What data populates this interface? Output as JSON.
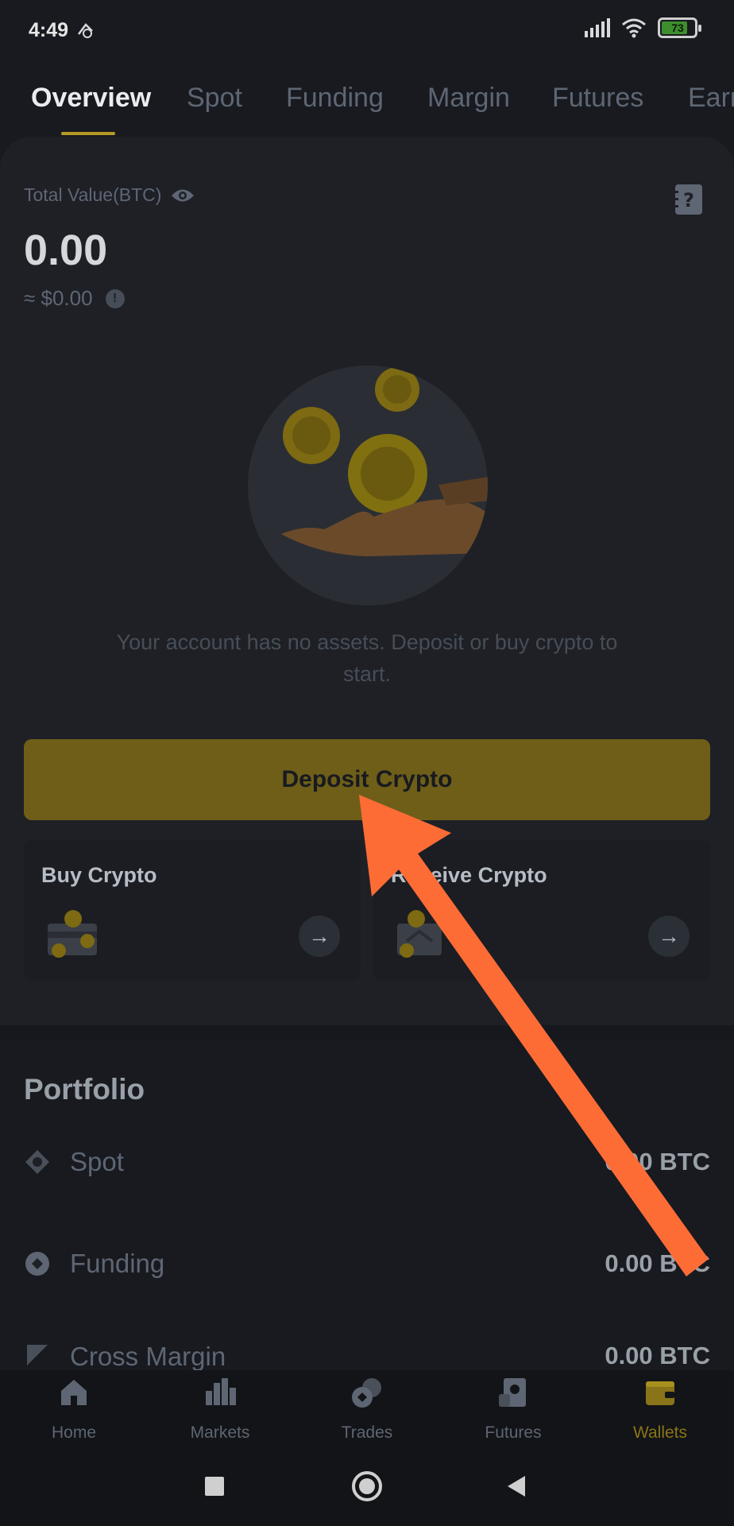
{
  "status_bar": {
    "time": "4:49",
    "battery_level": "73",
    "battery_fraction": 0.73
  },
  "tabs": [
    "Overview",
    "Spot",
    "Funding",
    "Margin",
    "Futures",
    "Earn"
  ],
  "overview": {
    "total_label": "Total Value(BTC)",
    "total_value": "0.00",
    "total_fiat": "≈ $0.00",
    "empty_message": "Your account has no assets. Deposit or buy crypto to start.",
    "deposit_button": "Deposit Crypto"
  },
  "actions": {
    "buy_label": "Buy Crypto",
    "receive_label": "Receive Crypto"
  },
  "portfolio": {
    "title": "Portfolio",
    "rows": [
      {
        "label": "Spot",
        "value": "0.00 BTC"
      },
      {
        "label": "Funding",
        "value": "0.00 BTC"
      },
      {
        "label": "Cross Margin",
        "value": "0.00 BTC"
      }
    ]
  },
  "bottom_nav": [
    "Home",
    "Markets",
    "Trades",
    "Futures",
    "Wallets"
  ],
  "colors": {
    "accent": "#f0b90b",
    "annotation_arrow": "#fe6c36",
    "background": "#181a20"
  },
  "icons": [
    "eye-icon",
    "report-icon",
    "info-icon",
    "arrow-right-icon",
    "home-icon",
    "markets-icon",
    "trades-icon",
    "futures-icon",
    "wallets-icon"
  ]
}
